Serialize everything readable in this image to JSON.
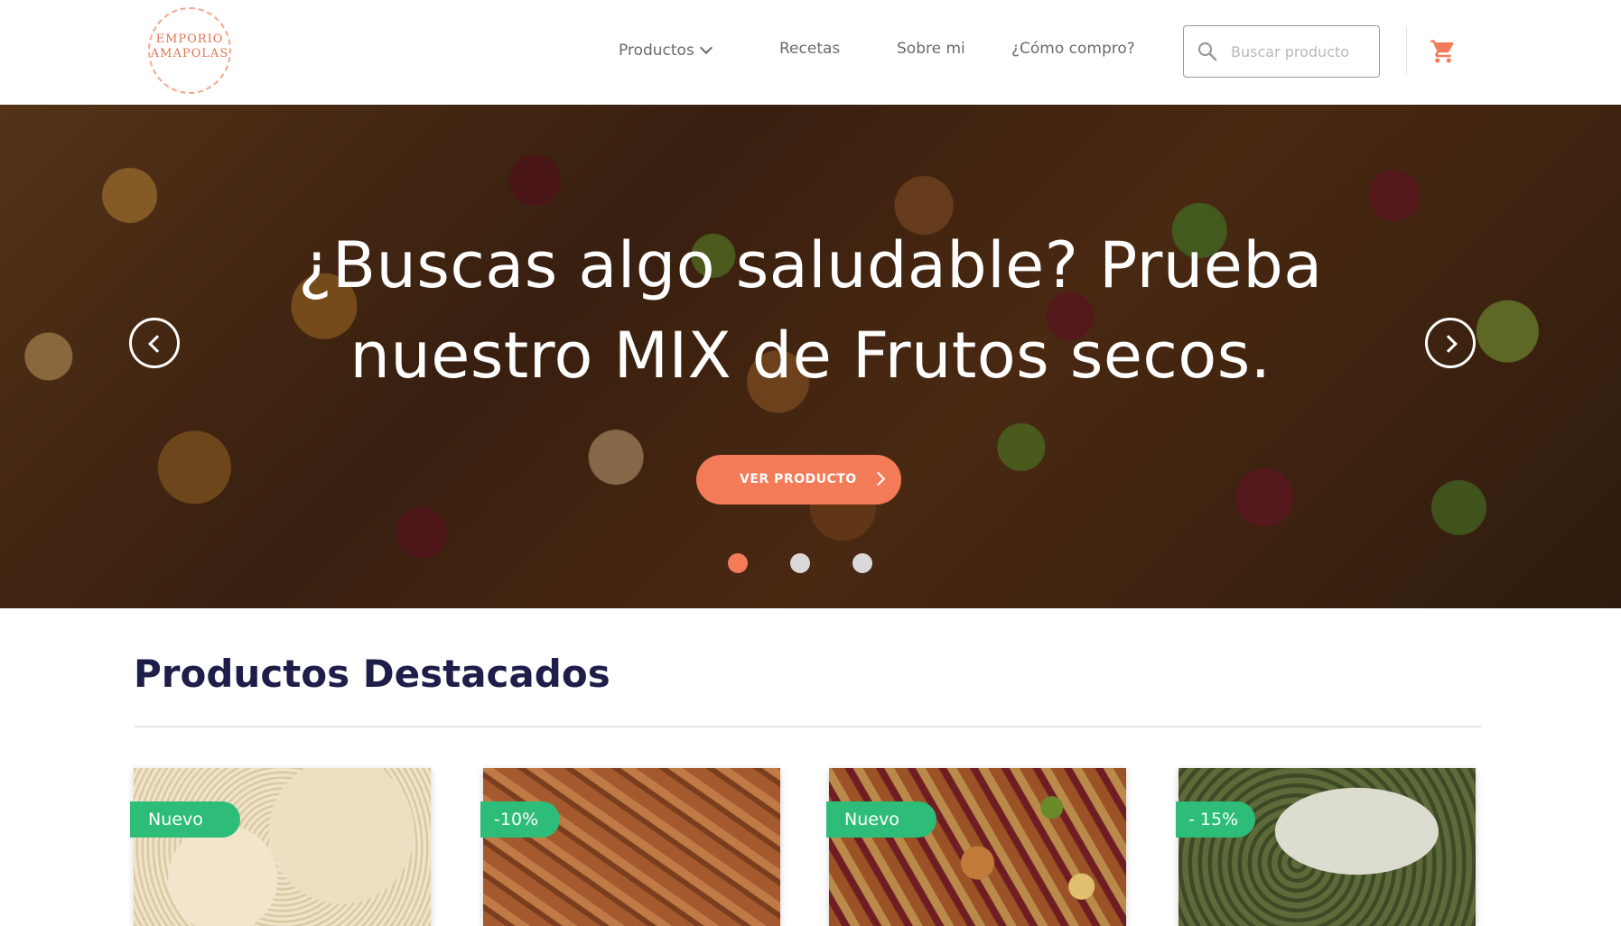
{
  "brand": {
    "logo_line1": "EMPORIO",
    "logo_line2": "AMAPOLAS"
  },
  "nav": {
    "productos": "Productos",
    "recetas": "Recetas",
    "sobre_mi": "Sobre mi",
    "como_compro": "¿Cómo compro?"
  },
  "search": {
    "placeholder": "Buscar producto",
    "value": ""
  },
  "icons": {
    "search": "search-icon",
    "cart": "cart-icon",
    "prev": "chevron-left-icon",
    "next": "chevron-right-icon"
  },
  "colors": {
    "accent": "#f37b58",
    "badge": "#2ebd78",
    "heading": "#1f1d4a"
  },
  "hero": {
    "title": "¿Buscas algo saludable? Prueba nuestro MIX de Frutos secos.",
    "cta_label": "VER PRODUCTO",
    "slides_total": 3,
    "active_slide": 1
  },
  "featured": {
    "title": "Productos Destacados",
    "products": [
      {
        "badge": "Nuevo"
      },
      {
        "badge": "-10%"
      },
      {
        "badge": "Nuevo"
      },
      {
        "badge": "- 15%"
      }
    ]
  }
}
